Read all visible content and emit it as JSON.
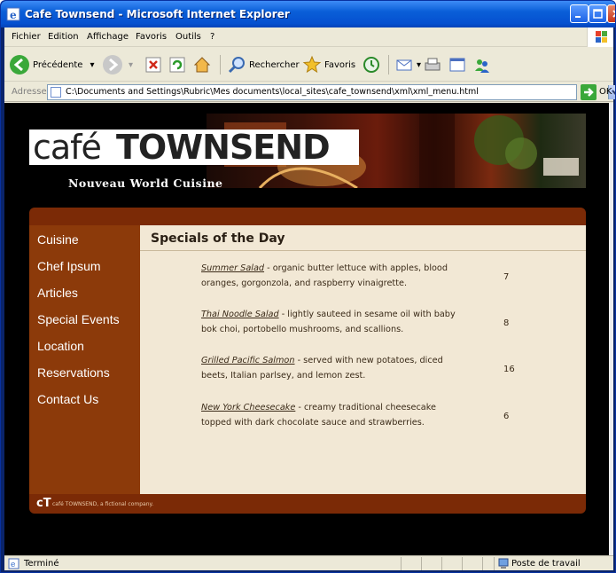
{
  "window": {
    "title": "Cafe Townsend - Microsoft Internet Explorer"
  },
  "menubar": {
    "items": [
      "Fichier",
      "Edition",
      "Affichage",
      "Favoris",
      "Outils",
      "?"
    ]
  },
  "toolbar": {
    "back_label": "Précédente",
    "search_label": "Rechercher",
    "favorites_label": "Favoris"
  },
  "addressbar": {
    "label": "Adresse",
    "url": "C:\\Documents and Settings\\Rubric\\Mes documents\\local_sites\\cafe_townsend\\xml\\xml_menu.html",
    "go_label": "OK"
  },
  "site": {
    "logo_cafe": "café",
    "logo_townsend": "TOWNSEND",
    "tagline": "Nouveau World Cuisine",
    "nav": [
      "Cuisine",
      "Chef Ipsum",
      "Articles",
      "Special Events",
      "Location",
      "Reservations",
      "Contact Us"
    ],
    "heading": "Specials of the Day",
    "menu": [
      {
        "dish": "Summer Salad",
        "desc": " - organic butter lettuce with apples, blood oranges, gorgonzola, and raspberry vinaigrette.",
        "price": "7"
      },
      {
        "dish": "Thai Noodle Salad",
        "desc": " - lightly sauteed in sesame oil with baby bok choi, portobello mushrooms, and scallions.",
        "price": "8"
      },
      {
        "dish": "Grilled Pacific Salmon",
        "desc": " - served with new potatoes, diced beets, Italian parlsey, and lemon zest.",
        "price": "16"
      },
      {
        "dish": "New York Cheesecake",
        "desc": " - creamy traditional cheesecake topped with dark chocolate sauce and strawberries.",
        "price": "6"
      }
    ],
    "footer_logo": "cT",
    "footer_text": "café TOWNSEND, a fictional company."
  },
  "statusbar": {
    "text": "Terminé",
    "zone": "Poste de travail"
  },
  "colors": {
    "nav_bg": "#8c3a0a",
    "content_bg": "#f2e8d5",
    "frame_bar": "#7b2a06"
  }
}
